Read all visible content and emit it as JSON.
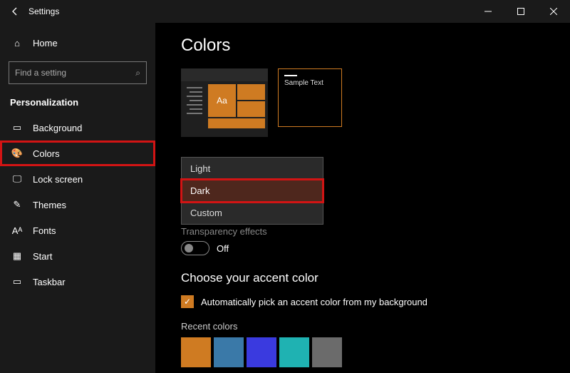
{
  "window": {
    "title": "Settings"
  },
  "sidebar": {
    "home_label": "Home",
    "search_placeholder": "Find a setting",
    "category_label": "Personalization",
    "items": [
      {
        "label": "Background",
        "glyph": "▭"
      },
      {
        "label": "Colors",
        "glyph": "🎨",
        "highlight": true
      },
      {
        "label": "Lock screen",
        "glyph": "🖵"
      },
      {
        "label": "Themes",
        "glyph": "✎"
      },
      {
        "label": "Fonts",
        "glyph": "Aᴬ"
      },
      {
        "label": "Start",
        "glyph": "▦"
      },
      {
        "label": "Taskbar",
        "glyph": "▭"
      }
    ]
  },
  "page": {
    "title": "Colors",
    "sample_text": "Sample Text",
    "aa": "Aa",
    "dropdown": {
      "options": [
        "Light",
        "Dark",
        "Custom"
      ],
      "selected": "Dark"
    },
    "obscured_label": "Transparency effects",
    "toggle_state": "Off",
    "accent_section_title": "Choose your accent color",
    "auto_pick_label": "Automatically pick an accent color from my background",
    "recent_colors_label": "Recent colors",
    "recent_colors": [
      "#cf7b22",
      "#3a79a8",
      "#3a3adf",
      "#1fb2b2",
      "#6b6b6b"
    ]
  }
}
